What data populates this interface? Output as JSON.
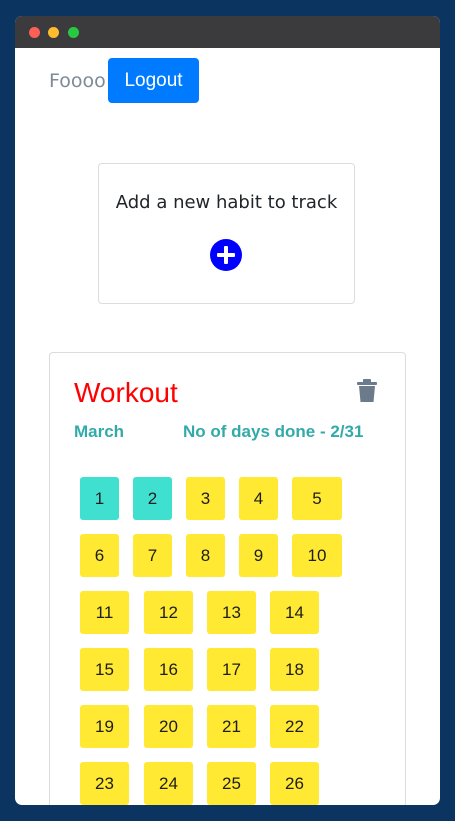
{
  "header": {
    "username": "Foooo",
    "logout_label": "Logout"
  },
  "add_card": {
    "title": "Add a new habit to track",
    "add_icon": "plus-circle-icon"
  },
  "habit": {
    "name": "Workout",
    "month": "March",
    "days_done": "No of days done - 2/31",
    "delete_icon": "trash-icon",
    "days": [
      {
        "label": "1",
        "done": true
      },
      {
        "label": "2",
        "done": true
      },
      {
        "label": "3",
        "done": false
      },
      {
        "label": "4",
        "done": false
      },
      {
        "label": "5",
        "done": false
      },
      {
        "label": "6",
        "done": false
      },
      {
        "label": "7",
        "done": false
      },
      {
        "label": "8",
        "done": false
      },
      {
        "label": "9",
        "done": false
      },
      {
        "label": "10",
        "done": false
      },
      {
        "label": "11",
        "done": false
      },
      {
        "label": "12",
        "done": false
      },
      {
        "label": "13",
        "done": false
      },
      {
        "label": "14",
        "done": false
      },
      {
        "label": "15",
        "done": false
      },
      {
        "label": "16",
        "done": false
      },
      {
        "label": "17",
        "done": false
      },
      {
        "label": "18",
        "done": false
      },
      {
        "label": "19",
        "done": false
      },
      {
        "label": "20",
        "done": false
      },
      {
        "label": "21",
        "done": false
      },
      {
        "label": "22",
        "done": false
      },
      {
        "label": "23",
        "done": false
      },
      {
        "label": "24",
        "done": false
      },
      {
        "label": "25",
        "done": false
      },
      {
        "label": "26",
        "done": false
      }
    ]
  },
  "colors": {
    "done": "#40e0d0",
    "pending": "#ffe933",
    "accent": "#007bff",
    "habit_title": "#ff0000",
    "subtitle": "#33aaaa"
  }
}
